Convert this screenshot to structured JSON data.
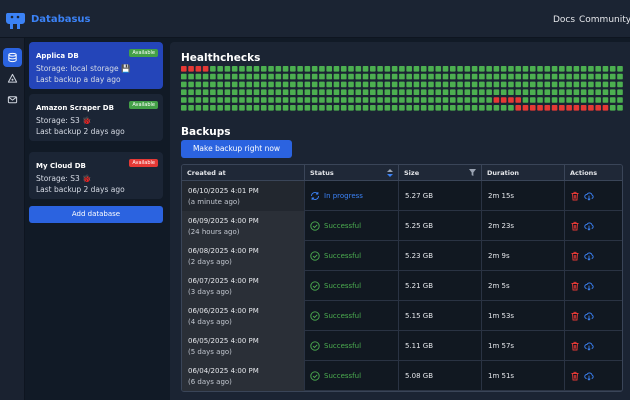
{
  "app": {
    "title": "Databasus"
  },
  "topnav": {
    "docs": "Docs",
    "community": "Community"
  },
  "rail": {
    "icons": [
      "database-icon",
      "notifier-icon",
      "mail-icon"
    ]
  },
  "databases": [
    {
      "name": "Applica DB",
      "status": "Available",
      "storage": "Storage: local storage 💾",
      "last_backup": "Last backup a day ago",
      "selected": true
    },
    {
      "name": "Amazon Scraper DB",
      "status": "Available",
      "storage": "Storage: S3 🐞",
      "last_backup": "Last backup 2 days ago",
      "selected": false
    },
    {
      "name": "My Cloud DB",
      "status": "Available",
      "storage": "Storage: S3 🐞",
      "last_backup": "Last backup 2 days ago",
      "selected": false
    }
  ],
  "add_database_label": "Add database",
  "healthchecks": {
    "title": "Healthchecks",
    "colors": {
      "ok": "#4caf50",
      "fail": "#e53935"
    }
  },
  "backups": {
    "title": "Backups",
    "make_backup_label": "Make backup right now",
    "columns": [
      "Created at",
      "Status",
      "Size",
      "Duration",
      "Actions"
    ],
    "rows": [
      {
        "date": "06/10/2025 4:01 PM",
        "ago": "(a minute ago)",
        "status": "In progress",
        "size": "5.27 GB",
        "duration": "2m 15s"
      },
      {
        "date": "06/09/2025 4:00 PM",
        "ago": "(24 hours ago)",
        "status": "Successful",
        "size": "5.25 GB",
        "duration": "2m 23s"
      },
      {
        "date": "06/08/2025 4:00 PM",
        "ago": "(2 days ago)",
        "status": "Successful",
        "size": "5.23 GB",
        "duration": "2m 9s"
      },
      {
        "date": "06/07/2025 4:00 PM",
        "ago": "(3 days ago)",
        "status": "Successful",
        "size": "5.21 GB",
        "duration": "2m 5s"
      },
      {
        "date": "06/06/2025 4:00 PM",
        "ago": "(4 days ago)",
        "status": "Successful",
        "size": "5.15 GB",
        "duration": "1m 53s"
      },
      {
        "date": "06/05/2025 4:00 PM",
        "ago": "(5 days ago)",
        "status": "Successful",
        "size": "5.11 GB",
        "duration": "1m 57s"
      },
      {
        "date": "06/04/2025 4:00 PM",
        "ago": "(6 days ago)",
        "status": "Successful",
        "size": "5.08 GB",
        "duration": "1m 51s"
      }
    ]
  }
}
